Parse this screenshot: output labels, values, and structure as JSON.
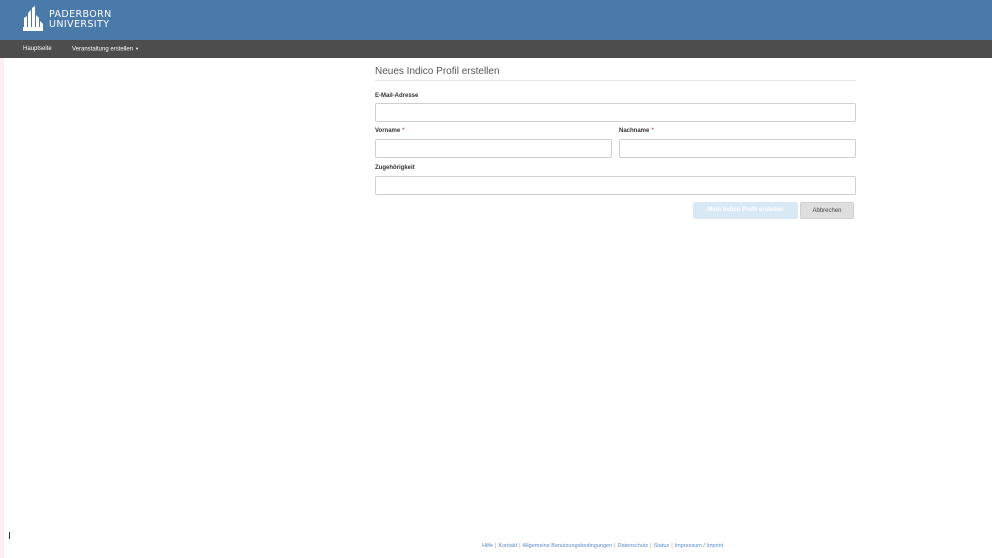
{
  "header": {
    "logo_line1": "PADERBORN",
    "logo_line2": "UNIVERSITY",
    "logo_icon": "paderborn-university-logo",
    "background_color": "#4a7aaa"
  },
  "navbar": {
    "items": [
      {
        "label": "Hauptseite"
      },
      {
        "label": "Veranstaltung erstellen",
        "icon": "caret-down-icon"
      }
    ],
    "background_color": "#4d4d4d"
  },
  "form": {
    "title": "Neues Indico Profil erstellen",
    "email_label": "E-Mail-Adresse",
    "email_value": "",
    "firstname_label": "Vorname",
    "firstname_value": "",
    "lastname_label": "Nachname",
    "lastname_value": "",
    "required_marker": "*",
    "affiliation_label": "Zugehörigkeit",
    "affiliation_value": "",
    "submit_label": "Mein Indico Profil erstellen",
    "cancel_label": "Abbrechen"
  },
  "footer": {
    "links": [
      "Hilfe",
      "Kontakt",
      "Allgemeine Benutzungsbedingungen",
      "Datenschutz",
      "Status",
      "Impressum / Imprint"
    ],
    "separator": "|"
  }
}
